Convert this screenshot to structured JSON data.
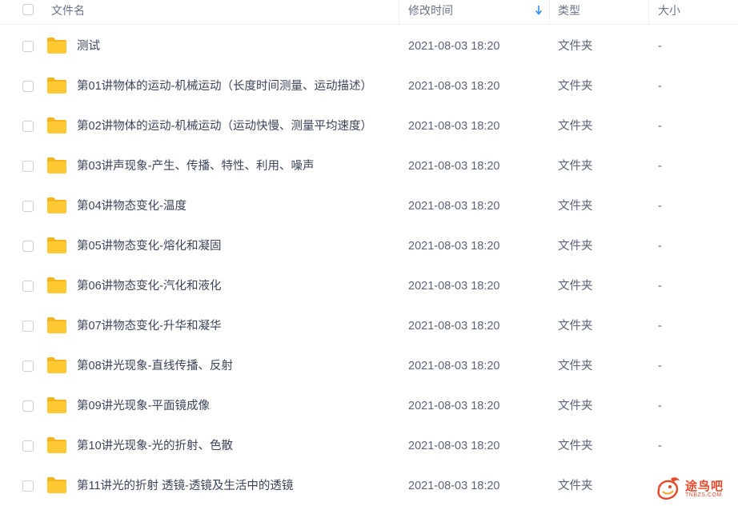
{
  "header": {
    "name_label": "文件名",
    "time_label": "修改时间",
    "type_label": "类型",
    "size_label": "大小"
  },
  "colors": {
    "folder": "#ffc933",
    "folder_tab": "#f5b41e",
    "sort_arrow": "#2f8cf0",
    "watermark": "#e8492c"
  },
  "files": [
    {
      "name": "测试",
      "time": "2021-08-03 18:20",
      "type": "文件夹",
      "size": "-"
    },
    {
      "name": "第01讲物体的运动-机械运动（长度时间测量、运动描述）",
      "time": "2021-08-03 18:20",
      "type": "文件夹",
      "size": "-"
    },
    {
      "name": "第02讲物体的运动-机械运动（运动快慢、测量平均速度）",
      "time": "2021-08-03 18:20",
      "type": "文件夹",
      "size": "-"
    },
    {
      "name": "第03讲声现象-产生、传播、特性、利用、噪声",
      "time": "2021-08-03 18:20",
      "type": "文件夹",
      "size": "-"
    },
    {
      "name": "第04讲物态变化-温度",
      "time": "2021-08-03 18:20",
      "type": "文件夹",
      "size": "-"
    },
    {
      "name": "第05讲物态变化-熔化和凝固",
      "time": "2021-08-03 18:20",
      "type": "文件夹",
      "size": "-"
    },
    {
      "name": "第06讲物态变化-汽化和液化",
      "time": "2021-08-03 18:20",
      "type": "文件夹",
      "size": "-"
    },
    {
      "name": "第07讲物态变化-升华和凝华",
      "time": "2021-08-03 18:20",
      "type": "文件夹",
      "size": "-"
    },
    {
      "name": "第08讲光现象-直线传播、反射",
      "time": "2021-08-03 18:20",
      "type": "文件夹",
      "size": "-"
    },
    {
      "name": "第09讲光现象-平面镜成像",
      "time": "2021-08-03 18:20",
      "type": "文件夹",
      "size": "-"
    },
    {
      "name": "第10讲光现象-光的折射、色散",
      "time": "2021-08-03 18:20",
      "type": "文件夹",
      "size": "-"
    },
    {
      "name": "第11讲光的折射 透镜-透镜及生活中的透镜",
      "time": "2021-08-03 18:20",
      "type": "文件夹",
      "size": "-"
    }
  ],
  "watermark": {
    "text": "途鸟吧",
    "subtext": "TNBZS.COM"
  }
}
